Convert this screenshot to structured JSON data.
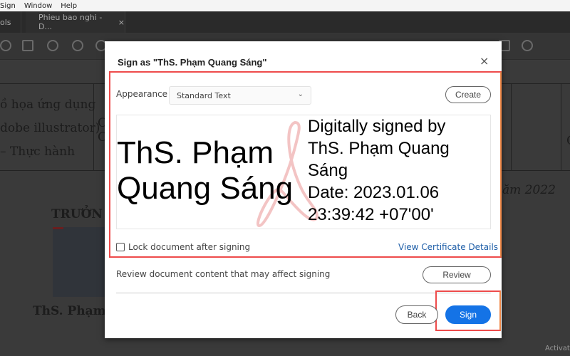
{
  "menubar": {
    "items": [
      "Sign",
      "Window",
      "Help"
    ]
  },
  "tabs": [
    {
      "label": "ols"
    },
    {
      "label": "Phieu bao nghi - D..."
    }
  ],
  "tab_close": "×",
  "document": {
    "lines": [
      "ồ họa ứng dụng",
      "dobe illustrator)",
      "– Thực hành"
    ],
    "col2_chars": [
      "C",
      "C"
    ],
    "right_char": "C",
    "date_fragment": "ăm 2022",
    "heading_fragment": "TRƯỞN",
    "signer_fragment": "ThS. Phạm"
  },
  "dialog": {
    "title": "Sign as \"ThS. Phạm Quang Sáng\"",
    "close_icon": "×",
    "appearance_label": "Appearance",
    "appearance_value": "Standard Text",
    "chevron_icon": "⌄",
    "create_label": "Create",
    "preview": {
      "name_line1": "ThS. Phạm",
      "name_line2": "Quang Sáng",
      "detail_lines": [
        "Digitally signed by",
        "ThS. Phạm Quang",
        "Sáng",
        "Date: 2023.01.06",
        "23:39:42 +07'00'"
      ]
    },
    "lock_label": "Lock document after signing",
    "lock_checked": false,
    "certificate_link": "View Certificate Details",
    "review_text": "Review document content that may affect signing",
    "review_label": "Review",
    "back_label": "Back",
    "sign_label": "Sign"
  },
  "colors": {
    "accent": "#1473e6",
    "highlight": "#ee4b4b",
    "link": "#1f5fa8"
  },
  "watermark": "Activat"
}
